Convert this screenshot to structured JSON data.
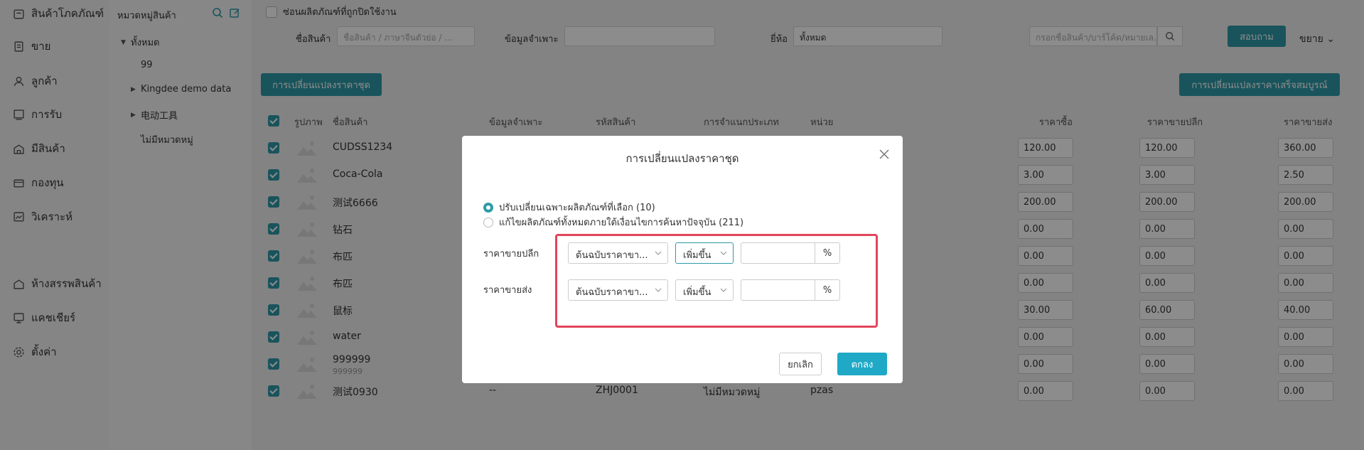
{
  "nav": {
    "items": [
      {
        "label": "สินค้าโภคภัณฑ์",
        "icon": "box-icon"
      },
      {
        "label": "ขาย",
        "icon": "receipt-icon"
      },
      {
        "label": "ลูกค้า",
        "icon": "user-icon"
      },
      {
        "label": "การรับ",
        "icon": "purchase-icon"
      },
      {
        "label": "มีสินค้า",
        "icon": "warehouse-icon"
      },
      {
        "label": "กองทุน",
        "icon": "wallet-icon"
      },
      {
        "label": "วิเคราะห์",
        "icon": "chart-icon"
      },
      {
        "label": "ห้างสรรพสินค้า",
        "icon": "store-icon"
      },
      {
        "label": "แคชเชียร์",
        "icon": "cashier-icon"
      },
      {
        "label": "ตั้งค่า",
        "icon": "gear-icon"
      }
    ]
  },
  "categories": {
    "title": "หมวดหมู่สินค้า",
    "items": [
      {
        "label": "ทั้งหมด"
      },
      {
        "label": "99"
      },
      {
        "label": "Kingdee demo data"
      },
      {
        "label": "电动工具"
      },
      {
        "label": "ไม่มีหมวดหมู่"
      }
    ]
  },
  "filters": {
    "hide_disabled": "ซ่อนผลิตภัณฑ์ที่ถูกปิดใช้งาน",
    "name_label": "ชื่อสินค้า",
    "name_placeholder": "ชื่อสินค้า / ภาษาจีนตัวย่อ / ...",
    "spec_label": "ข้อมูลจำเพาะ",
    "brand_label": "ยี่ห้อ",
    "brand_value": "ทั้งหมด",
    "search_placeholder": "กรอกชื่อสินค้า/บาร์โค้ด/หมายเล...",
    "query_button": "สอบถาม",
    "expand": "ขยาย"
  },
  "actions": {
    "batch_price": "การเปลี่ยนแปลงราคาชุด",
    "full_price": "การเปลี่ยนแปลงราคาเสร็จสมบูรณ์"
  },
  "table": {
    "headers": {
      "image": "รูปภาพ",
      "name": "ชื่อสินค้า",
      "spec": "ข้อมูลจำเพาะ",
      "code": "รหัสสินค้า",
      "category": "การจำแนกประเภท",
      "unit": "หน่วย",
      "purchase": "ราคาซื้อ",
      "retail": "ราคาขายปลีก",
      "wholesale": "ราคาขายส่ง"
    },
    "rows": [
      {
        "name": "CUDSS1234",
        "purchase": "120.00",
        "retail": "120.00",
        "wholesale": "360.00"
      },
      {
        "name": "Coca-Cola",
        "purchase": "3.00",
        "retail": "3.00",
        "wholesale": "2.50"
      },
      {
        "name": "测试6666",
        "purchase": "200.00",
        "retail": "200.00",
        "wholesale": "200.00"
      },
      {
        "name": "钻石",
        "purchase": "0.00",
        "retail": "0.00",
        "wholesale": "0.00"
      },
      {
        "name": "布匹",
        "purchase": "0.00",
        "retail": "0.00",
        "wholesale": "0.00"
      },
      {
        "name": "布匹",
        "purchase": "0.00",
        "retail": "0.00",
        "wholesale": "0.00"
      },
      {
        "name": "鼠标",
        "purchase": "30.00",
        "retail": "60.00",
        "wholesale": "40.00"
      },
      {
        "name": "water",
        "purchase": "0.00",
        "retail": "0.00",
        "wholesale": "0.00"
      },
      {
        "name": "999999",
        "sub": "999999",
        "purchase": "0.00",
        "retail": "0.00",
        "wholesale": "0.00"
      },
      {
        "name": "测试0930",
        "spec": "--",
        "code": "ZHJ0001",
        "category": "ไม่มีหมวดหมู่",
        "unit": "pzas",
        "purchase": "0.00",
        "retail": "0.00",
        "wholesale": "0.00"
      }
    ]
  },
  "modal": {
    "title": "การเปลี่ยนแปลงราคาชุด",
    "option_selected": "ปรับเปลี่ยนเฉพาะผลิตภัณฑ์ที่เลือก (10)",
    "option_all": "แก้ไขผลิตภัณฑ์ทั้งหมดภายใต้เงื่อนไขการค้นหาปัจจุบัน (211)",
    "retail_label": "ราคาขายปลีก",
    "wholesale_label": "ราคาขายส่ง",
    "base_select": "ต้นฉบับราคาขา...",
    "op_select": "เพิ่มขึ้น",
    "percent": "%",
    "cancel": "ยกเลิก",
    "ok": "ตกลง"
  }
}
